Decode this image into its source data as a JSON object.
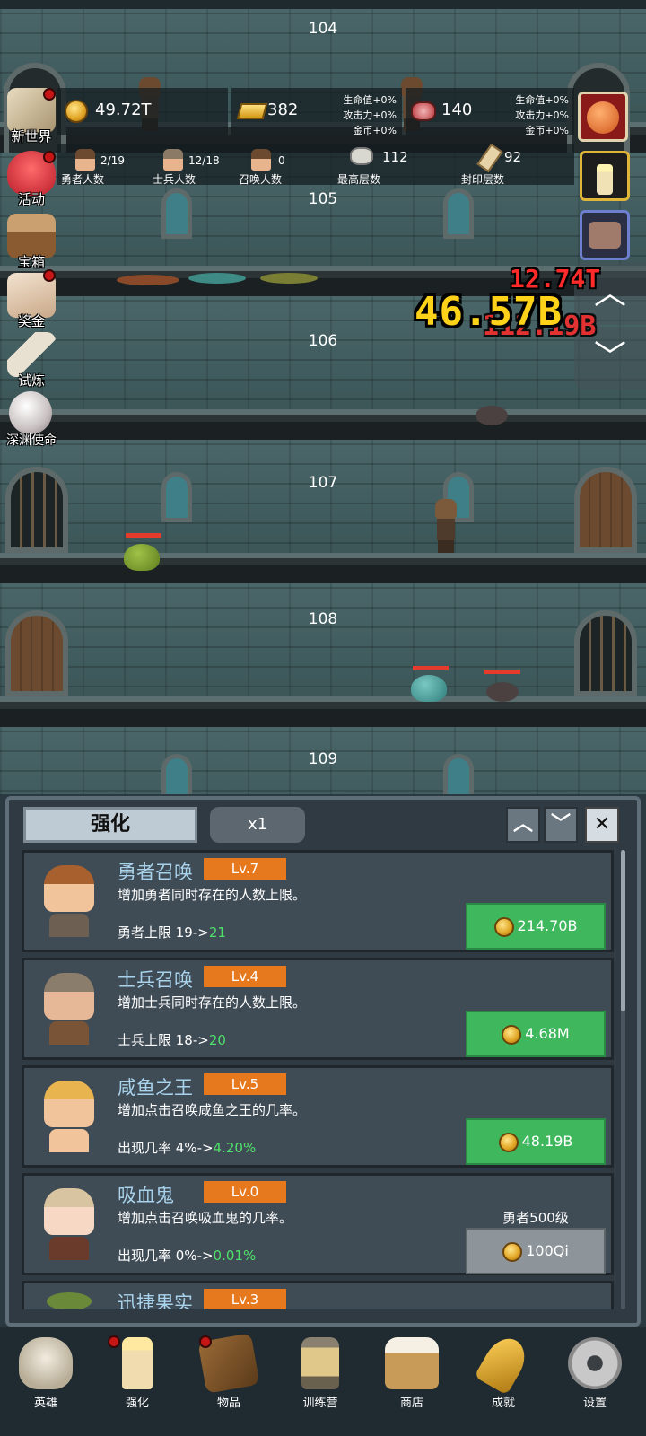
{
  "floors": [
    "104",
    "105",
    "106",
    "107",
    "108",
    "109"
  ],
  "hud": {
    "gold": "49.72T",
    "gold_bars": "382",
    "meat": "140",
    "bonus_left": [
      "生命值+0%",
      "攻击力+0%",
      "金币+0%"
    ],
    "bonus_right": [
      "生命值+0%",
      "攻击力+0%",
      "金币+0%"
    ],
    "hero_count": {
      "value": "2/19",
      "label": "勇者人数"
    },
    "soldier_count": {
      "value": "12/18",
      "label": "士兵人数"
    },
    "summon_count": {
      "value": "0",
      "label": "召唤人数"
    },
    "max_floor": {
      "value": "112",
      "label": "最高层数"
    },
    "sealed_floor": {
      "value": "92",
      "label": "封印层数"
    }
  },
  "side_menu": [
    {
      "label": "新世界",
      "dot": true
    },
    {
      "label": "活动",
      "dot": true
    },
    {
      "label": "宝箱",
      "dot": false
    },
    {
      "label": "奖金",
      "dot": true
    },
    {
      "label": "试炼",
      "dot": false
    },
    {
      "label": "深渊使命",
      "dot": false
    }
  ],
  "damage": {
    "big": "46.57B",
    "red_top": "12.74T",
    "red_under": "112.19B"
  },
  "nav_arrows": {
    "up": "︿",
    "down": "﹀"
  },
  "panel": {
    "tab": "强化",
    "multiplier": "x1",
    "up": "︿",
    "down": "﹀",
    "close": "✕"
  },
  "upgrades": [
    {
      "name": "勇者召唤",
      "level": "Lv.7",
      "desc": "增加勇者同时存在的人数上限。",
      "stat_prefix": "勇者上限 19->",
      "stat_new": "21",
      "cost": "214.70B",
      "req": "",
      "enabled": true
    },
    {
      "name": "士兵召唤",
      "level": "Lv.4",
      "desc": "增加士兵同时存在的人数上限。",
      "stat_prefix": "士兵上限 18->",
      "stat_new": "20",
      "cost": "4.68M",
      "req": "",
      "enabled": true
    },
    {
      "name": "咸鱼之王",
      "level": "Lv.5",
      "desc": "增加点击召唤咸鱼之王的几率。",
      "stat_prefix": "出现几率 4%->",
      "stat_new": "4.20%",
      "cost": "48.19B",
      "req": "",
      "enabled": true
    },
    {
      "name": "吸血鬼",
      "level": "Lv.0",
      "desc": "增加点击召唤吸血鬼的几率。",
      "stat_prefix": "出现几率 0%->",
      "stat_new": "0.01%",
      "cost": "100Qi",
      "req": "勇者500级",
      "enabled": false
    },
    {
      "name": "迅捷果实",
      "level": "Lv.3",
      "desc": "",
      "stat_prefix": "",
      "stat_new": "",
      "cost": "",
      "req": "",
      "enabled": true
    }
  ],
  "bottom_nav": [
    {
      "label": "英雄",
      "icon": "skull-icon",
      "dot": false
    },
    {
      "label": "强化",
      "icon": "candle-icon",
      "dot": true
    },
    {
      "label": "物品",
      "icon": "book-icon",
      "dot": true
    },
    {
      "label": "训练营",
      "icon": "lantern-icon",
      "dot": false
    },
    {
      "label": "商店",
      "icon": "beer-icon",
      "dot": false
    },
    {
      "label": "成就",
      "icon": "key-icon",
      "dot": false
    },
    {
      "label": "设置",
      "icon": "gear-icon",
      "dot": false
    }
  ],
  "colors": {
    "buy_green": "#3fb85d",
    "level_orange": "#e6781e",
    "title_blue": "#a9d3ec",
    "stat_green": "#4fe06a"
  }
}
